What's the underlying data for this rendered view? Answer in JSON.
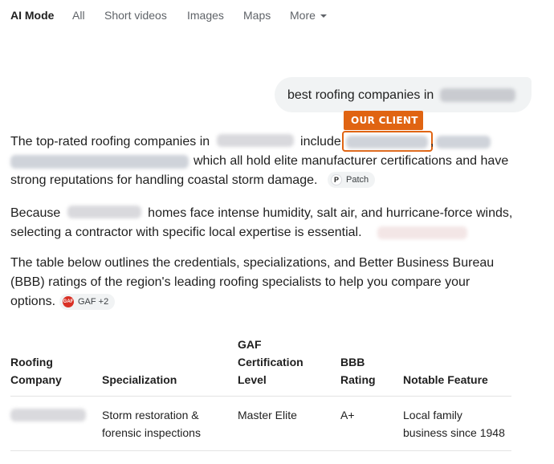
{
  "nav": {
    "tabs": [
      "AI Mode",
      "All",
      "Short videos",
      "Images",
      "Maps"
    ],
    "more_label": "More"
  },
  "query": {
    "text": "best roofing companies in"
  },
  "client_label": "OUR CLIENT",
  "paragraphs": {
    "p1_a": "The top-rated roofing companies in",
    "p1_b": "include",
    "p1_c": ",",
    "p1_d": "which all hold elite manufacturer certifications and have",
    "p1_e": "strong reputations for handling coastal storm damage.",
    "p2_a": "Because",
    "p2_b": "homes face intense humidity, salt air, and hurricane-force winds,",
    "p2_c": "selecting a contractor with specific local expertise is essential.",
    "p3_a": "The table below outlines the credentials, specializations, and Better Business Bureau",
    "p3_b": "(BBB) ratings of the region's leading roofing specialists to help you compare your",
    "p3_c": "options."
  },
  "sources": {
    "patch": {
      "icon_text": "P",
      "label": "Patch"
    },
    "gaf": {
      "icon_text": "GAF",
      "label": "GAF +2"
    }
  },
  "table": {
    "headers": {
      "company": [
        "Roofing",
        "Company"
      ],
      "specialization": "Specialization",
      "gaf": [
        "GAF",
        "Certification",
        "Level"
      ],
      "bbb": [
        "BBB",
        "Rating"
      ],
      "feature": "Notable Feature"
    },
    "rows": [
      {
        "specialization": [
          "Storm restoration &",
          "forensic inspections"
        ],
        "gaf": "Master Elite",
        "bbb": "A+",
        "feature": [
          "Local family",
          "business since 1948"
        ]
      }
    ]
  },
  "colors": {
    "accent": "#e06412",
    "chip_bg": "#f1f3f4",
    "gaf_red": "#d93025"
  }
}
